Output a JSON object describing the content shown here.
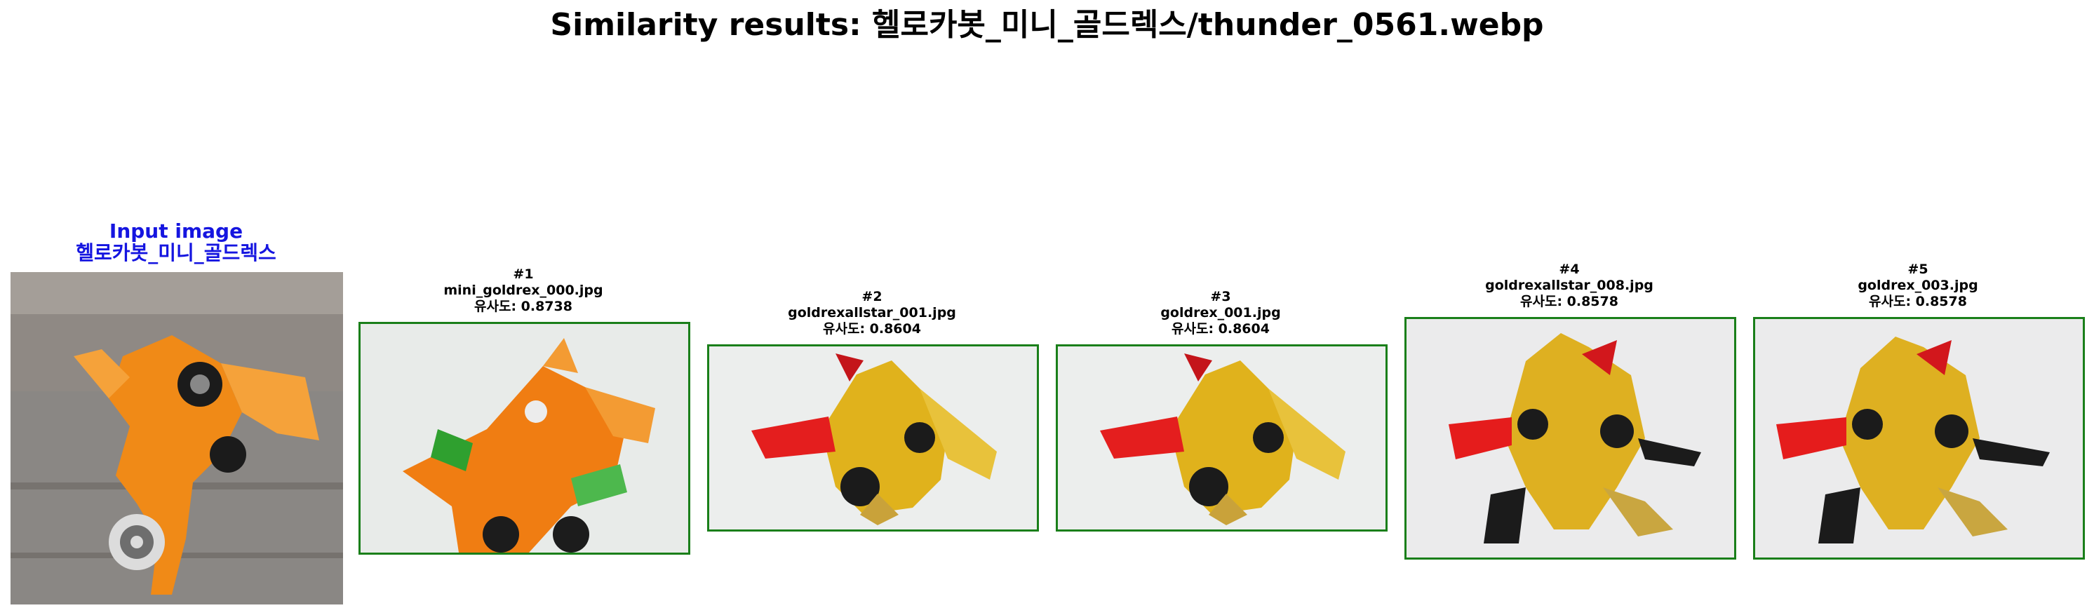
{
  "page_title": "Similarity results: 헬로카봇_미니_골드렉스/thunder_0561.webp",
  "input": {
    "label": "Input image",
    "category": "헬로카봇_미니_골드렉스",
    "caption_color": "#1515e0"
  },
  "result_border_color": "#1a7f1a",
  "results": [
    {
      "rank": "#1",
      "filename": "mini_goldrex_000.jpg",
      "similarity": "유사도: 0.8738"
    },
    {
      "rank": "#2",
      "filename": "goldrexallstar_001.jpg",
      "similarity": "유사도: 0.8604"
    },
    {
      "rank": "#3",
      "filename": "goldrex_001.jpg",
      "similarity": "유사도: 0.8604"
    },
    {
      "rank": "#4",
      "filename": "goldrexallstar_008.jpg",
      "similarity": "유사도: 0.8578"
    },
    {
      "rank": "#5",
      "filename": "goldrex_003.jpg",
      "similarity": "유사도: 0.8578"
    }
  ],
  "images": {
    "input": "orange-toy-robot-dragon-on-stairs-photo",
    "result_1": "orange-toy-robot-dragon-photo",
    "result_2": "gold-toy-robot-dragon-with-red-claw-photo",
    "result_3": "gold-toy-robot-dragon-with-red-claw-photo",
    "result_4": "gold-toy-robot-dragon-standing-photo",
    "result_5": "gold-toy-robot-dragon-standing-photo"
  }
}
